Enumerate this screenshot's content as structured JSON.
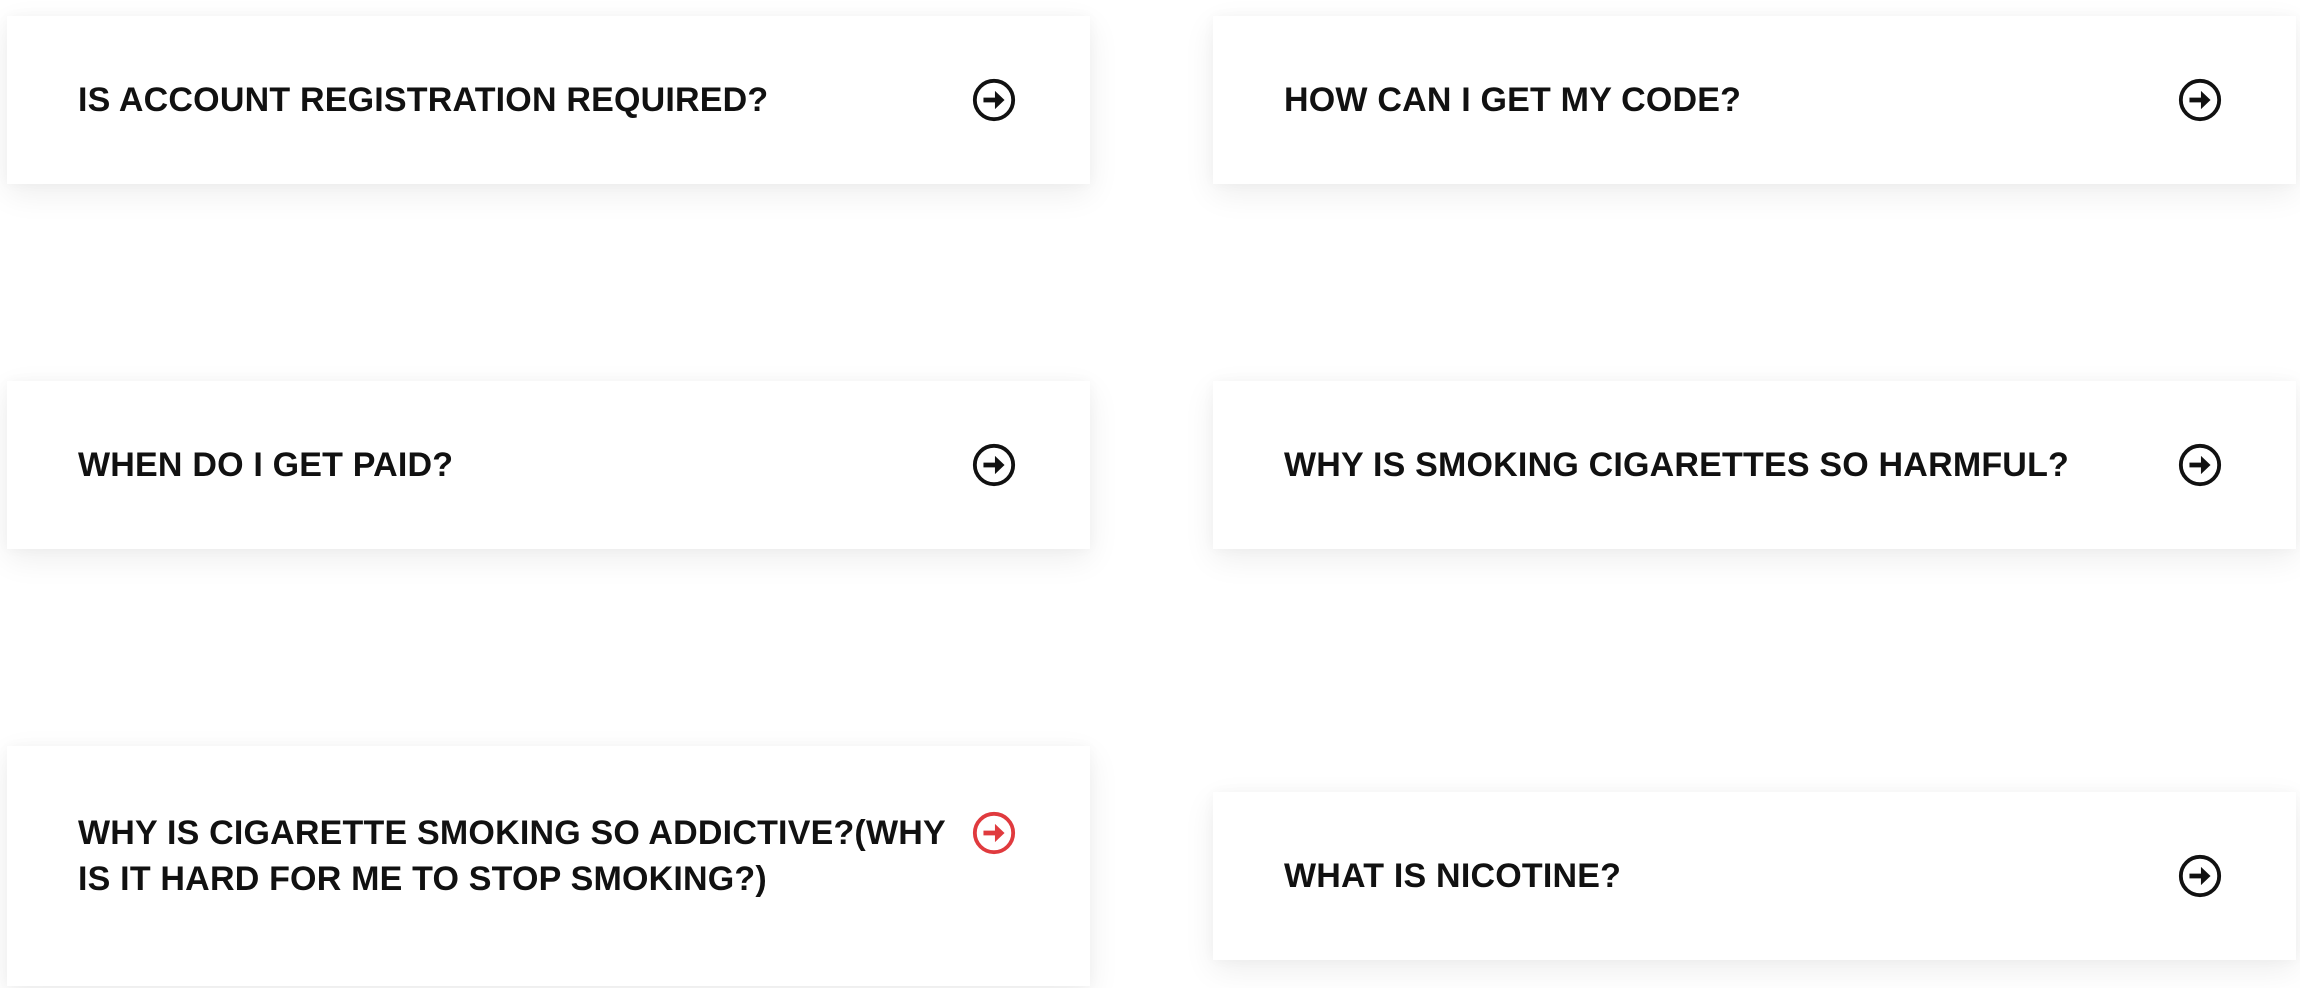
{
  "faq": {
    "items": [
      {
        "question": "IS ACCOUNT REGISTRATION REQUIRED?",
        "icon": "arrow-circle-right-icon",
        "icon_color": "#111111"
      },
      {
        "question": "HOW CAN I GET MY CODE?",
        "icon": "arrow-circle-right-icon",
        "icon_color": "#111111"
      },
      {
        "question": "WHEN DO I GET PAID?",
        "icon": "arrow-circle-right-icon",
        "icon_color": "#111111"
      },
      {
        "question": "WHY IS SMOKING CIGARETTES SO HARMFUL?",
        "icon": "arrow-circle-right-icon",
        "icon_color": "#111111"
      },
      {
        "question": "WHY IS CIGARETTE SMOKING SO ADDICTIVE?(WHY IS IT HARD FOR ME TO STOP SMOKING?)",
        "icon": "arrow-circle-right-icon",
        "icon_color": "#e03a3e",
        "state": "hovered"
      },
      {
        "question": "WHAT IS NICOTINE?",
        "icon": "arrow-circle-right-icon",
        "icon_color": "#111111"
      }
    ]
  }
}
